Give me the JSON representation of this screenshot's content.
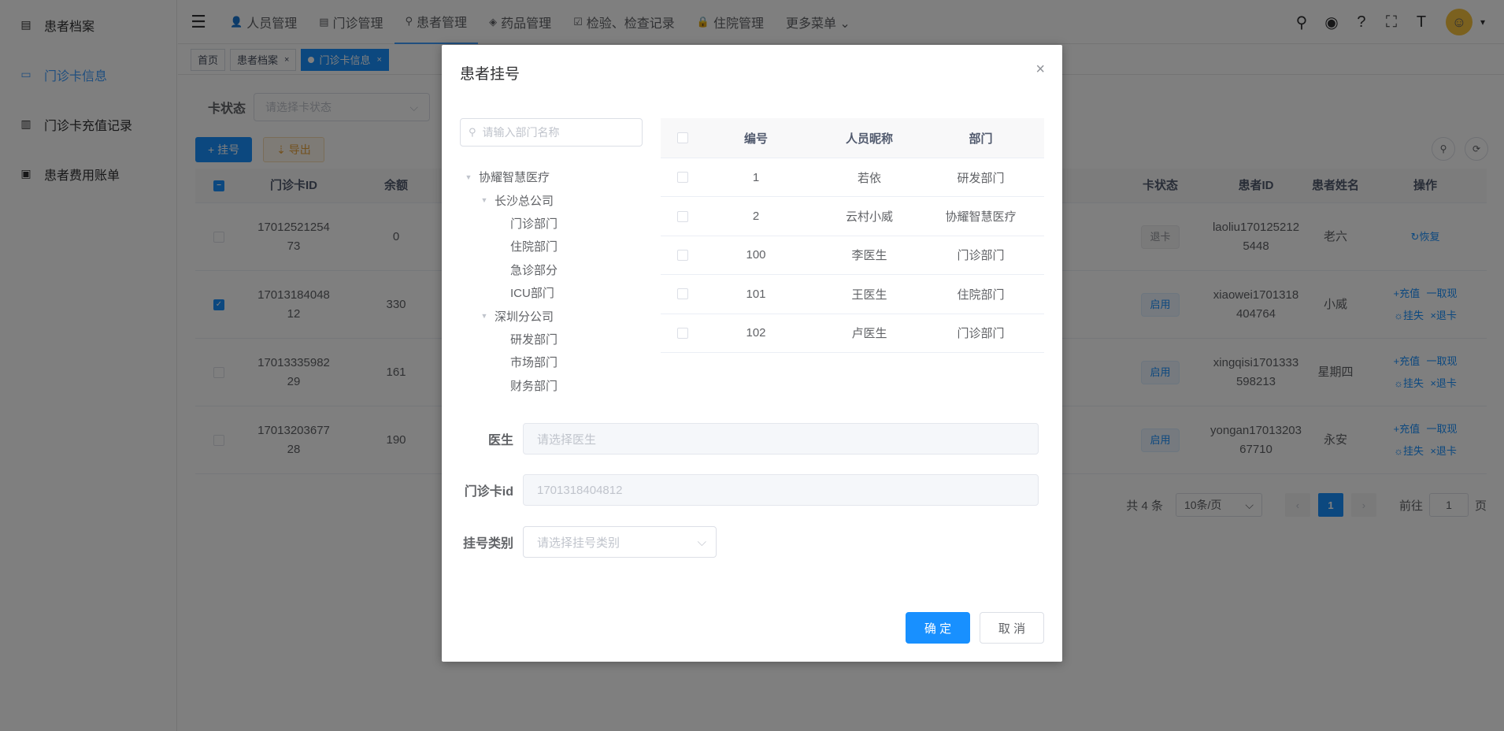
{
  "sidebar": {
    "items": [
      {
        "label": "患者档案",
        "icon": "document-icon",
        "glyph": "▤",
        "active": false
      },
      {
        "label": "门诊卡信息",
        "icon": "card-icon",
        "glyph": "▭",
        "active": true
      },
      {
        "label": "门诊卡充值记录",
        "icon": "bar-chart-icon",
        "glyph": "▥",
        "active": false
      },
      {
        "label": "患者费用账单",
        "icon": "bill-icon",
        "glyph": "▣",
        "active": false
      }
    ]
  },
  "header": {
    "menu_glyph": "☰",
    "menu": [
      {
        "label": "人员管理",
        "glyph": "👤"
      },
      {
        "label": "门诊管理",
        "glyph": "▤"
      },
      {
        "label": "患者管理",
        "glyph": "⚲"
      },
      {
        "label": "药品管理",
        "glyph": "◈"
      },
      {
        "label": "检验、检查记录",
        "glyph": "☑"
      },
      {
        "label": "住院管理",
        "glyph": "🔒"
      },
      {
        "label": "更多菜单 ⌄",
        "glyph": ""
      }
    ],
    "right_icons": [
      {
        "name": "search-icon",
        "glyph": "⚲"
      },
      {
        "name": "github-icon",
        "glyph": "◉"
      },
      {
        "name": "help-icon",
        "glyph": "?"
      },
      {
        "name": "fullscreen-icon",
        "glyph": "⛶"
      },
      {
        "name": "font-size-icon",
        "glyph": "T"
      }
    ],
    "avatar_glyph": "☺",
    "caret_glyph": "▾"
  },
  "tags": {
    "home": "首页",
    "archive": "患者档案",
    "current": "门诊卡信息",
    "close": "×"
  },
  "main": {
    "filter_label": "卡状态",
    "filter_placeholder": "请选择卡状态",
    "chevron": "⌵",
    "register_btn": "+ 挂号",
    "export_btn": "⇣ 导出",
    "search_circle": "⚲",
    "refresh_circle": "⟳",
    "columns": {
      "card_id": "门诊卡ID",
      "balance": "余额",
      "state": "卡状态",
      "patient_id": "患者ID",
      "patient_name": "患者姓名",
      "ops": "操作"
    },
    "rows": [
      {
        "card_id": "1701252125473",
        "balance": "0",
        "state": "退卡",
        "patient_id": "laoliu1701252125448",
        "name": "老六",
        "ops": [
          "↻恢复"
        ]
      },
      {
        "card_id": "1701318404812",
        "balance": "330",
        "state": "启用",
        "patient_id": "xiaowei1701318404764",
        "name": "小威",
        "ops": [
          "+充值",
          "一取现",
          "☼挂失",
          "×退卡"
        ]
      },
      {
        "card_id": "1701333598229",
        "balance": "161",
        "state": "启用",
        "patient_id": "xingqisi1701333598213",
        "name": "星期四",
        "ops": [
          "+充值",
          "一取现",
          "☼挂失",
          "×退卡"
        ]
      },
      {
        "card_id": "1701320367728",
        "balance": "190",
        "state": "启用",
        "patient_id": "yongan1701320367710",
        "name": "永安",
        "ops": [
          "+充值",
          "一取现",
          "☼挂失",
          "×退卡"
        ]
      }
    ],
    "pager": {
      "total": "共 4 条",
      "size": "10条/页",
      "prev": "‹",
      "current": "1",
      "next": "›",
      "goto": "前往",
      "goto_value": "1",
      "page_unit": "页"
    }
  },
  "dialog": {
    "title": "患者挂号",
    "close": "×",
    "tree_search_placeholder": "请输入部门名称",
    "tree_search_glyph": "⚲",
    "tree": [
      {
        "label": "协耀智慧医疗",
        "level": 0
      },
      {
        "label": "长沙总公司",
        "level": 1
      },
      {
        "label": "门诊部门",
        "level": 2
      },
      {
        "label": "住院部门",
        "level": 2
      },
      {
        "label": "急诊部分",
        "level": 2
      },
      {
        "label": "ICU部门",
        "level": 2
      },
      {
        "label": "深圳分公司",
        "level": 1
      },
      {
        "label": "研发部门",
        "level": 2
      },
      {
        "label": "市场部门",
        "level": 2
      },
      {
        "label": "财务部门",
        "level": 2
      }
    ],
    "tree_arrow": "▼",
    "user_columns": {
      "no": "编号",
      "nick": "人员昵称",
      "dept": "部门"
    },
    "users": [
      {
        "no": "1",
        "nick": "若依",
        "dept": "研发部门"
      },
      {
        "no": "2",
        "nick": "云村小威",
        "dept": "协耀智慧医疗"
      },
      {
        "no": "100",
        "nick": "李医生",
        "dept": "门诊部门"
      },
      {
        "no": "101",
        "nick": "王医生",
        "dept": "住院部门"
      },
      {
        "no": "102",
        "nick": "卢医生",
        "dept": "门诊部门"
      }
    ],
    "doctor_label": "医生",
    "doctor_placeholder": "请选择医生",
    "card_label": "门诊卡id",
    "card_value": "1701318404812",
    "type_label": "挂号类别",
    "type_placeholder": "请选择挂号类别",
    "type_chevron": "⌵",
    "ok": "确 定",
    "cancel": "取 消"
  },
  "colors": {
    "primary": "#1890ff",
    "warning": "#e6a23c",
    "overlay": "rgba(0,0,0,0.5)"
  }
}
